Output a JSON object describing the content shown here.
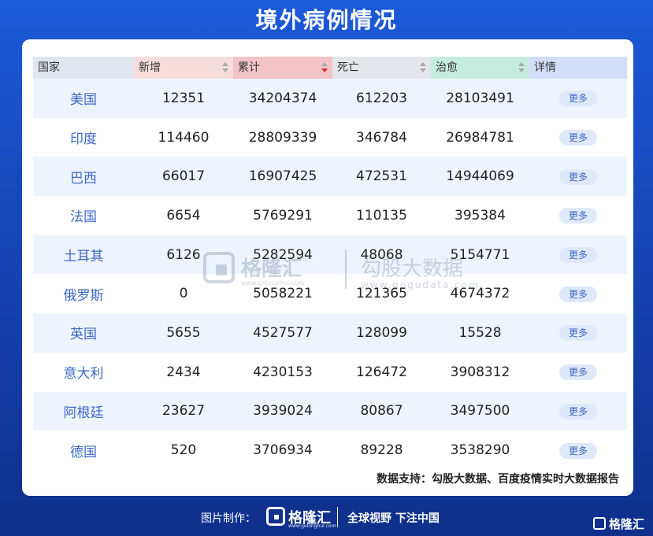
{
  "title": "境外病例情况",
  "table": {
    "headers": [
      {
        "label": "国家",
        "bg": "#dfe6ee",
        "sort": false
      },
      {
        "label": "新增",
        "bg": "#f7dcdc",
        "sort": true,
        "active": false
      },
      {
        "label": "累计",
        "bg": "#f2c4c8",
        "sort": true,
        "active": true
      },
      {
        "label": "死亡",
        "bg": "#e3e6ea",
        "sort": true,
        "active": false
      },
      {
        "label": "治愈",
        "bg": "#c6ecdf",
        "sort": true,
        "active": false
      },
      {
        "label": "详情",
        "bg": "#d4defa",
        "sort": false
      }
    ],
    "more_label": "更多",
    "rows": [
      {
        "country": "美国",
        "new": "12351",
        "total": "34204374",
        "deaths": "612203",
        "cured": "28103491"
      },
      {
        "country": "印度",
        "new": "114460",
        "total": "28809339",
        "deaths": "346784",
        "cured": "26984781"
      },
      {
        "country": "巴西",
        "new": "66017",
        "total": "16907425",
        "deaths": "472531",
        "cured": "14944069"
      },
      {
        "country": "法国",
        "new": "6654",
        "total": "5769291",
        "deaths": "110135",
        "cured": "395384"
      },
      {
        "country": "土耳其",
        "new": "6126",
        "total": "5282594",
        "deaths": "48068",
        "cured": "5154771"
      },
      {
        "country": "俄罗斯",
        "new": "0",
        "total": "5058221",
        "deaths": "121365",
        "cured": "4674372"
      },
      {
        "country": "英国",
        "new": "5655",
        "total": "4527577",
        "deaths": "128099",
        "cured": "15528"
      },
      {
        "country": "意大利",
        "new": "2434",
        "total": "4230153",
        "deaths": "126472",
        "cured": "3908312"
      },
      {
        "country": "阿根廷",
        "new": "23627",
        "total": "3939024",
        "deaths": "80867",
        "cured": "3497500"
      },
      {
        "country": "德国",
        "new": "520",
        "total": "3706934",
        "deaths": "89228",
        "cured": "3538290"
      }
    ]
  },
  "source": "数据支持：勾股大数据、百度疫情实时大数据报告",
  "watermark": {
    "brand": "格隆汇",
    "brand_url": "www.gelonghui.com",
    "partner": "勾股大数据",
    "partner_url": "www.gogudata.com"
  },
  "footer": {
    "label": "图片制作：",
    "brand": "格隆汇",
    "brand_url": "www.gelonghui.com",
    "slogan": "全球视野 下注中国"
  },
  "corner": {
    "brand": "格隆汇"
  }
}
